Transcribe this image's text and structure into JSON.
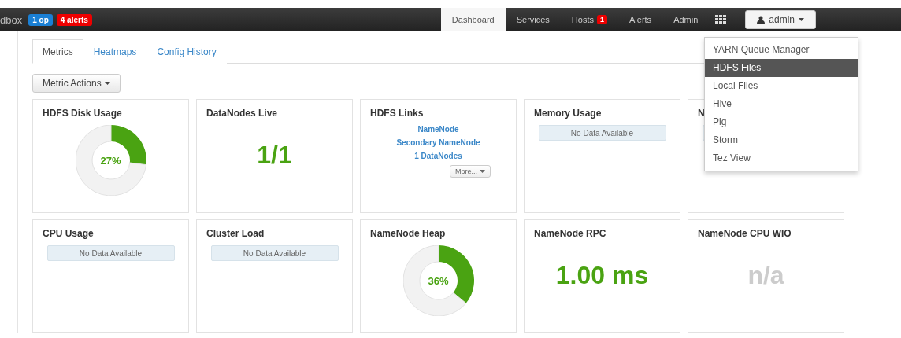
{
  "navbar": {
    "brand": "dbox",
    "ops_badge": "1 op",
    "alerts_badge": "4 alerts",
    "items": [
      {
        "label": "Dashboard",
        "selected": true
      },
      {
        "label": "Services",
        "selected": false
      },
      {
        "label": "Hosts",
        "selected": false,
        "badge": "1"
      },
      {
        "label": "Alerts",
        "selected": false
      },
      {
        "label": "Admin",
        "selected": false
      }
    ],
    "user": "admin"
  },
  "user_menu": {
    "items": [
      {
        "label": "YARN Queue Manager",
        "selected": false
      },
      {
        "label": "HDFS Files",
        "selected": true
      },
      {
        "label": "Local Files",
        "selected": false
      },
      {
        "label": "Hive",
        "selected": false
      },
      {
        "label": "Pig",
        "selected": false
      },
      {
        "label": "Storm",
        "selected": false
      },
      {
        "label": "Tez View",
        "selected": false
      }
    ]
  },
  "tabs": [
    {
      "label": "Metrics",
      "selected": true
    },
    {
      "label": "Heatmaps",
      "selected": false
    },
    {
      "label": "Config History",
      "selected": false
    }
  ],
  "metric_actions": "Metric Actions",
  "widgets": [
    {
      "kind": "donut",
      "title": "HDFS Disk Usage",
      "value": "27%",
      "chart_data": {
        "type": "donut",
        "values": [
          27,
          73
        ]
      }
    },
    {
      "kind": "big",
      "title": "DataNodes Live",
      "value": "1/1",
      "muted": false
    },
    {
      "kind": "links",
      "title": "HDFS Links",
      "links": [
        "NameNode",
        "Secondary NameNode",
        "1 DataNodes"
      ],
      "more": "More..."
    },
    {
      "kind": "nodata",
      "title": "Memory Usage",
      "message": "No Data Available"
    },
    {
      "kind": "covered",
      "title": "N"
    },
    {
      "kind": "nodata",
      "title": "CPU Usage",
      "message": "No Data Available"
    },
    {
      "kind": "nodata",
      "title": "Cluster Load",
      "message": "No Data Available"
    },
    {
      "kind": "donut",
      "title": "NameNode Heap",
      "value": "36%",
      "chart_data": {
        "type": "donut",
        "values": [
          36,
          64
        ]
      }
    },
    {
      "kind": "big",
      "title": "NameNode RPC",
      "value": "1.00 ms",
      "muted": false
    },
    {
      "kind": "big",
      "title": "NameNode CPU WIO",
      "value": "n/a",
      "muted": true
    }
  ]
}
